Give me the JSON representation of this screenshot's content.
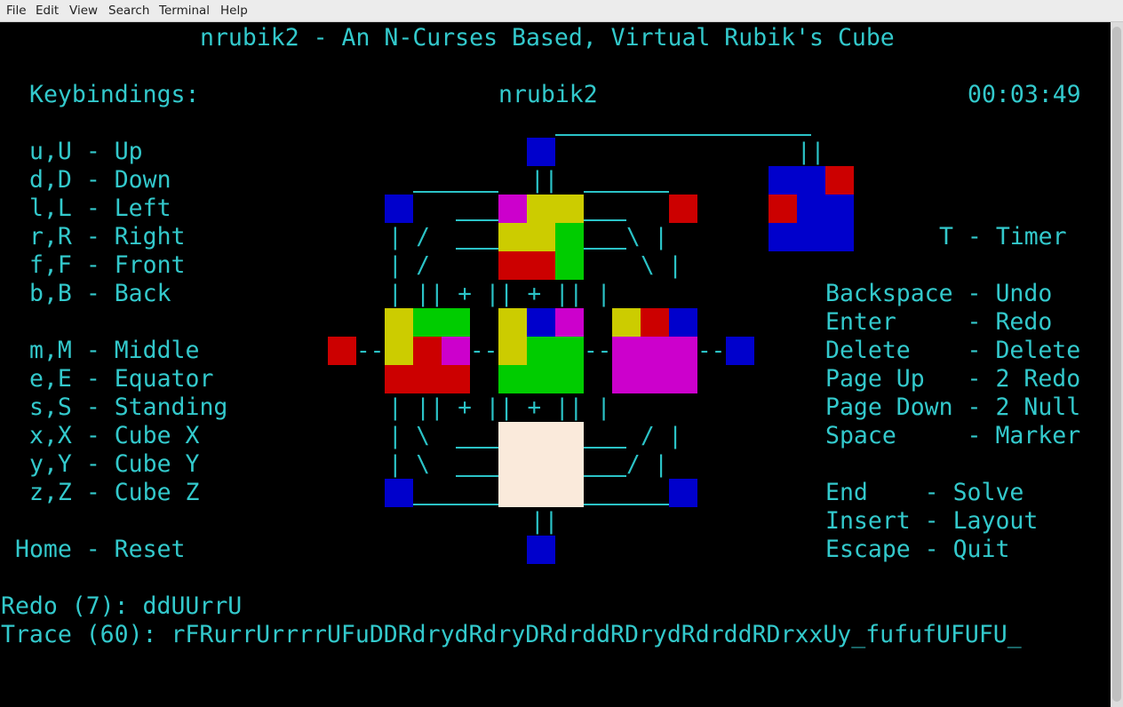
{
  "menubar": {
    "items": [
      "File",
      "Edit",
      "View",
      "Search",
      "Terminal",
      "Help"
    ]
  },
  "terminal": {
    "header": "nrubik2 - An N-Curses Based, Virtual Rubik's Cube",
    "keybindings_title": "Keybindings:",
    "center_title": "nrubik2",
    "timer": "00:03:49",
    "keys_left": [
      "u,U - Up",
      "d,D - Down",
      "l,L - Left",
      "r,R - Right",
      "f,F - Front",
      "b,B - Back",
      "m,M - Middle",
      "e,E - Equator",
      "s,S - Standing",
      "x,X - Cube X",
      "y,Y - Cube Y",
      "z,Z - Cube Z"
    ],
    "reset": "Home - Reset",
    "timer_key": "T - Timer",
    "keys_right": [
      "Backspace - Undo",
      "Enter     - Redo",
      "Delete    - Delete",
      "Page Up   - 2 Redo",
      "Page Down - 2 Null",
      "Space     - Marker"
    ],
    "keys_right2": [
      "End    - Solve",
      "Insert - Layout",
      "Escape - Quit"
    ],
    "redo_line": "Redo (7): ddUUrrU",
    "trace_line": "Trace (60): rFRurrUrrrrUFuDDRdrydRdryDRdrddRDrydRdrddRDrxxUy_fufufUFUFU_"
  },
  "cube": {
    "colors": {
      "blue": "#0000cc",
      "red": "#cc0000",
      "yellow": "#cccc00",
      "green": "#00cc00",
      "magenta": "#cc00cc",
      "cream": "#faeadb"
    }
  }
}
